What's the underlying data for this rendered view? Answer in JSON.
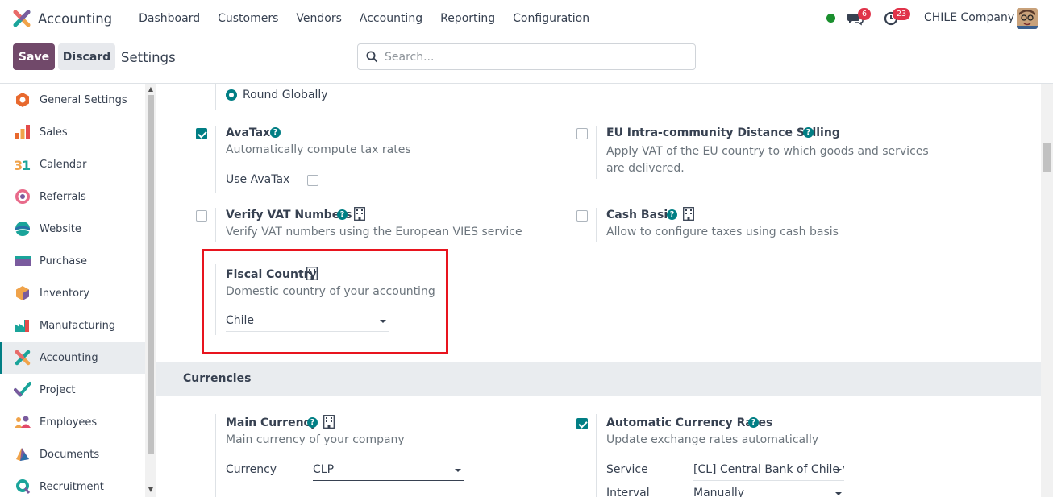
{
  "app": {
    "name": "Accounting"
  },
  "menu": [
    "Dashboard",
    "Customers",
    "Vendors",
    "Accounting",
    "Reporting",
    "Configuration"
  ],
  "systray": {
    "messages_count": "6",
    "activities_count": "23",
    "company": "CHILE Company"
  },
  "control": {
    "save": "Save",
    "discard": "Discard",
    "title": "Settings",
    "search_placeholder": "Search..."
  },
  "sidebar": [
    {
      "label": "General Settings",
      "icon": "general-settings-icon"
    },
    {
      "label": "Sales",
      "icon": "sales-icon"
    },
    {
      "label": "Calendar",
      "icon": "calendar-icon"
    },
    {
      "label": "Referrals",
      "icon": "referrals-icon"
    },
    {
      "label": "Website",
      "icon": "website-icon"
    },
    {
      "label": "Purchase",
      "icon": "purchase-icon"
    },
    {
      "label": "Inventory",
      "icon": "inventory-icon"
    },
    {
      "label": "Manufacturing",
      "icon": "manufacturing-icon"
    },
    {
      "label": "Accounting",
      "icon": "accounting-icon",
      "active": true
    },
    {
      "label": "Project",
      "icon": "project-icon"
    },
    {
      "label": "Employees",
      "icon": "employees-icon"
    },
    {
      "label": "Documents",
      "icon": "documents-icon"
    },
    {
      "label": "Recruitment",
      "icon": "recruitment-icon"
    }
  ],
  "settings": {
    "rounding": {
      "label": "Round Globally"
    },
    "avatax": {
      "title": "AvaTax",
      "desc": "Automatically compute tax rates",
      "checked": true,
      "sub_label": "Use AvaTax"
    },
    "eu_distance": {
      "title": "EU Intra-community Distance Selling",
      "desc": "Apply VAT of the EU country to which goods and services are delivered.",
      "checked": false
    },
    "verify_vat": {
      "title": "Verify VAT Numbers",
      "desc": "Verify VAT numbers using the European VIES service",
      "checked": false
    },
    "cash_basis": {
      "title": "Cash Basis",
      "desc": "Allow to configure taxes using cash basis",
      "checked": false
    },
    "fiscal_country": {
      "title": "Fiscal Country",
      "desc": "Domestic country of your accounting",
      "value": "Chile"
    }
  },
  "currencies": {
    "section_title": "Currencies",
    "main_currency": {
      "title": "Main Currency",
      "desc": "Main currency of your company",
      "field_label": "Currency",
      "value": "CLP"
    },
    "auto_rates": {
      "title": "Automatic Currency Rates",
      "desc": "Update exchange rates automatically",
      "checked": true,
      "service_label": "Service",
      "service_value": "[CL] Central Bank of Chile v",
      "interval_label": "Interval",
      "interval_value": "Manually"
    }
  },
  "colors": {
    "brand": "#71496a",
    "accent": "#017e84",
    "highlight": "#e8141e",
    "badge": "#e0334a"
  }
}
